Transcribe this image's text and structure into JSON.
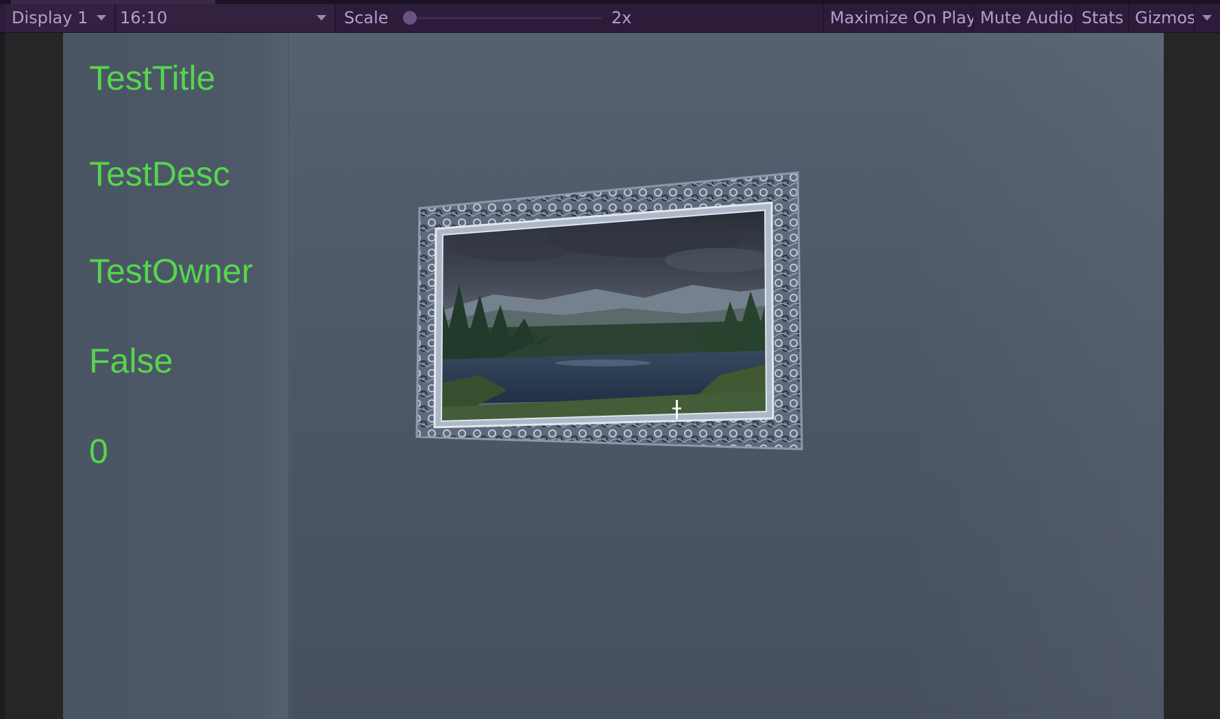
{
  "toolbar": {
    "display_label": "Display 1",
    "aspect_label": "16:10",
    "scale_label": "Scale",
    "scale_value": "2x",
    "scale_fraction": 0.0,
    "maximize_label": "Maximize On Play",
    "mute_label": "Mute Audio",
    "stats_label": "Stats",
    "gizmos_label": "Gizmos"
  },
  "overlay": {
    "title": "TestTitle",
    "description": "TestDesc",
    "owner": "TestOwner",
    "flag": "False",
    "count": "0"
  },
  "colors": {
    "toolbar_bg": "#2c1c3a",
    "toolbar_text": "#b59fcd",
    "overlay_text": "#55d64c",
    "wall": "#4d5766"
  },
  "icons": {
    "dropdown": "chevron-down-icon",
    "crosshair": "crosshair-icon"
  }
}
